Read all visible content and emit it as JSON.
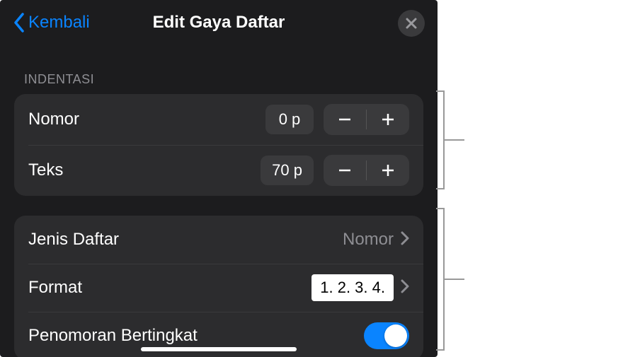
{
  "header": {
    "back_label": "Kembali",
    "title": "Edit Gaya Daftar"
  },
  "section": {
    "indentation_label": "INDENTASI"
  },
  "indent": {
    "number_label": "Nomor",
    "number_value": "0 p",
    "text_label": "Teks",
    "text_value": "70 p"
  },
  "list": {
    "type_label": "Jenis Daftar",
    "type_value": "Nomor",
    "format_label": "Format",
    "format_value": "1. 2. 3. 4.",
    "tiered_label": "Penomoran Bertingkat",
    "tiered_on": true
  },
  "colors": {
    "accent": "#0a84ff"
  }
}
